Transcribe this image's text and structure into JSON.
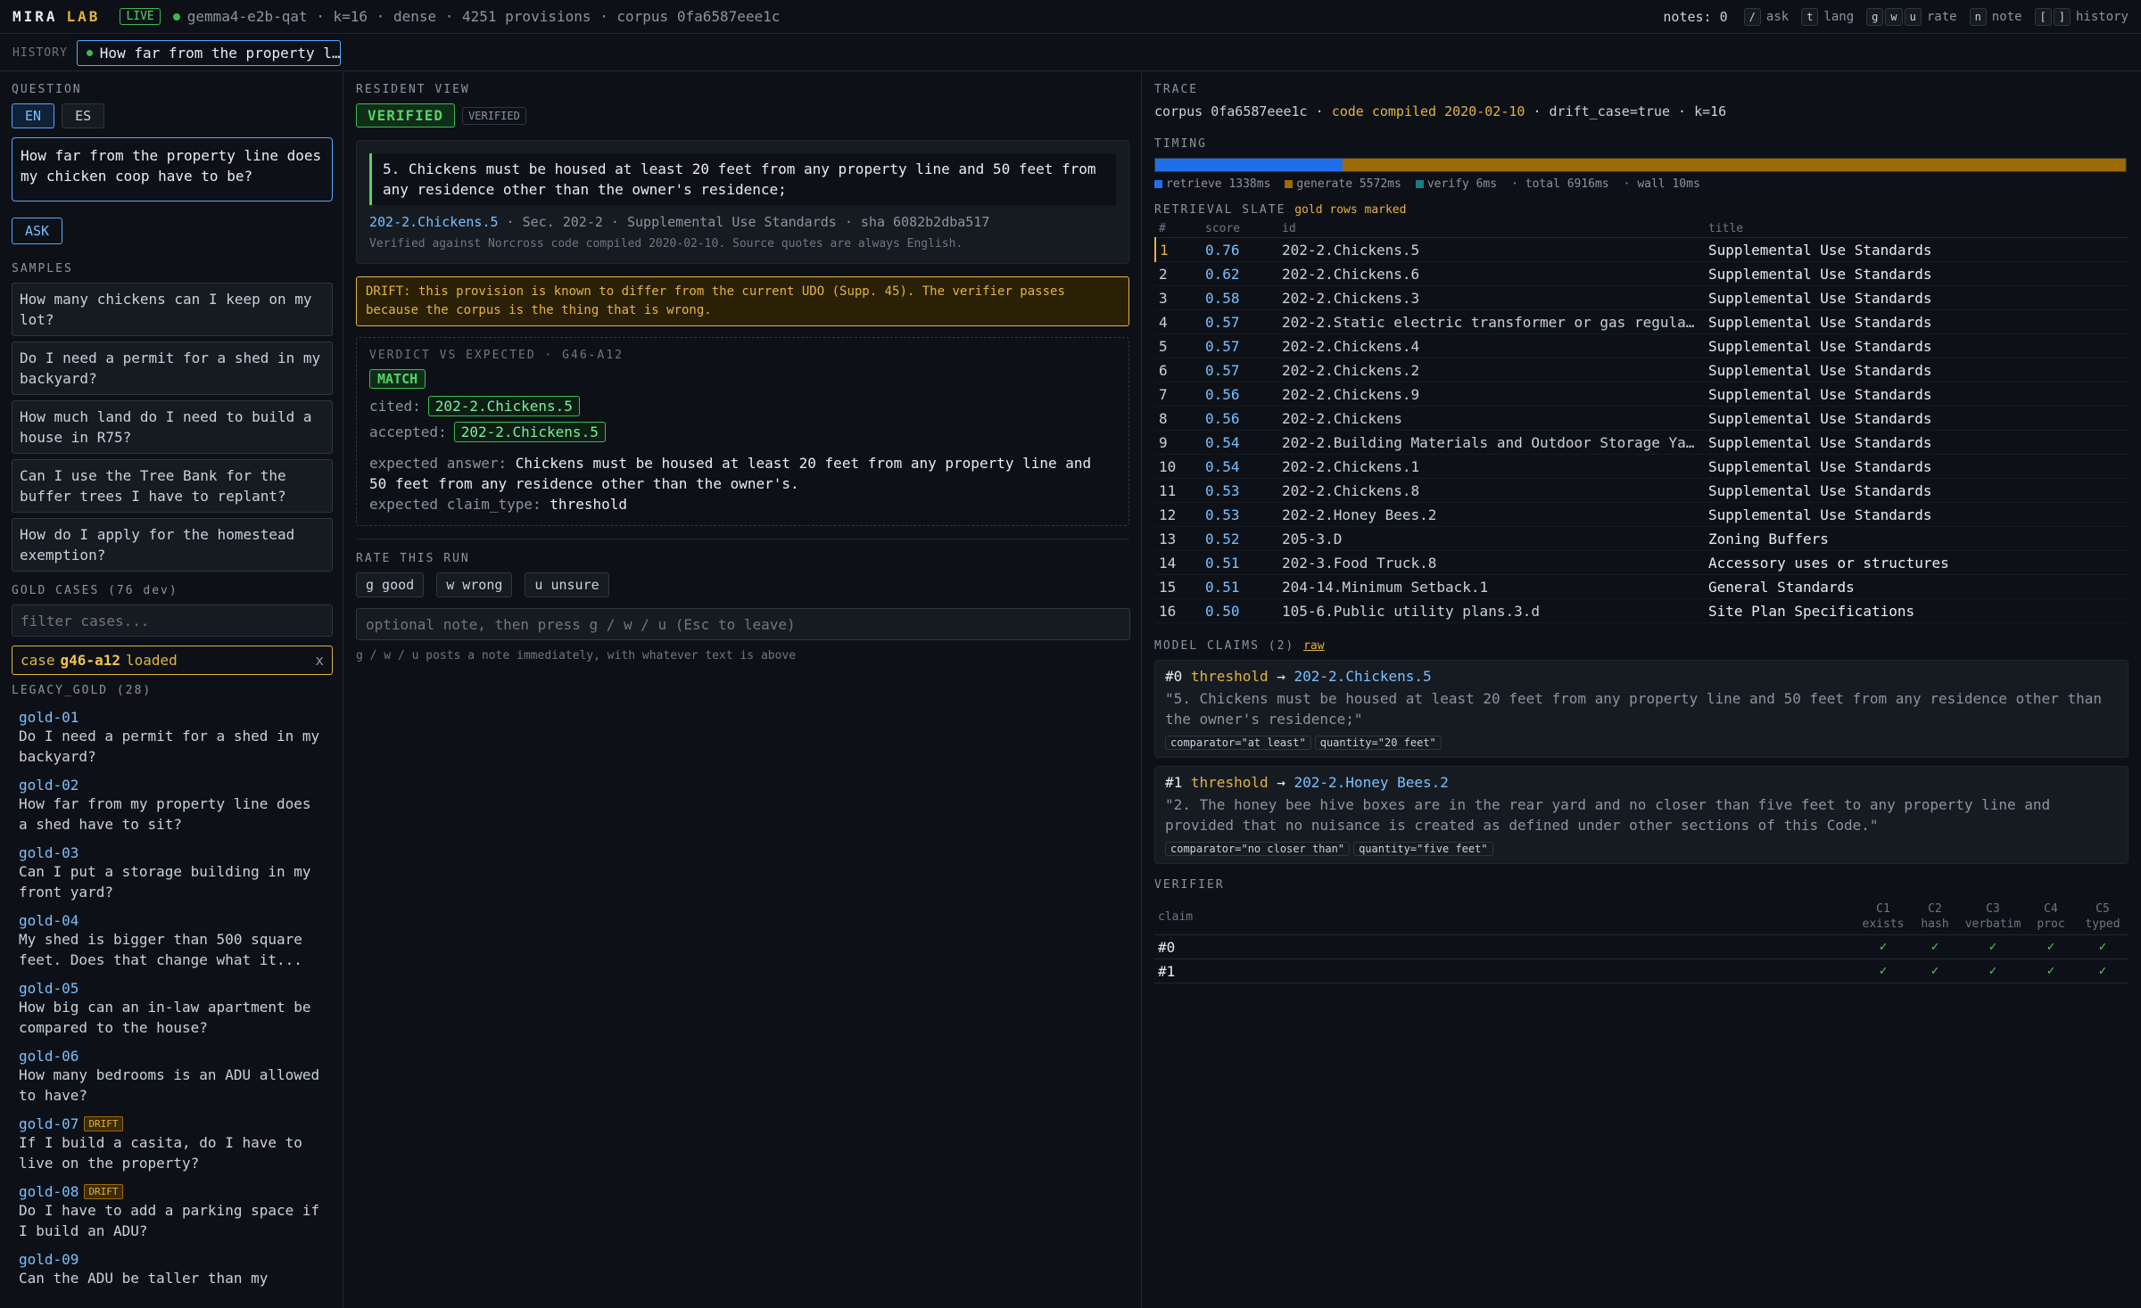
{
  "topbar": {
    "brand_a": "MIRA",
    "brand_b": "LAB",
    "live": "LIVE",
    "model_meta": "gemma4-e2b-qat · k=16 · dense · 4251 provisions · corpus 0fa6587eee1c",
    "notes": "notes: 0",
    "shortcuts": [
      {
        "keys": [
          "/"
        ],
        "label": "ask"
      },
      {
        "keys": [
          "t"
        ],
        "label": "lang"
      },
      {
        "keys": [
          "g",
          "w",
          "u"
        ],
        "label": "rate"
      },
      {
        "keys": [
          "n"
        ],
        "label": "note"
      },
      {
        "keys": [
          "[",
          "]"
        ],
        "label": "history"
      }
    ]
  },
  "history": {
    "label": "HISTORY",
    "chip": "How far from the property l…"
  },
  "left": {
    "question_heading": "QUESTION",
    "lang_en": "EN",
    "lang_es": "ES",
    "question_text": "How far from the property line does my chicken coop have to be?",
    "ask_label": "ASK",
    "samples_heading": "SAMPLES",
    "samples": [
      "How many chickens can I keep on my lot?",
      "Do I need a permit for a shed in my backyard?",
      "How much land do I need to build a house in R75?",
      "Can I use the Tree Bank for the buffer trees I have to replant?",
      "How do I apply for the homestead exemption?"
    ],
    "gold_heading": "GOLD CASES (76 dev)",
    "filter_placeholder": "filter cases...",
    "case_prefix": "case",
    "case_id": "g46-a12",
    "case_suffix": "loaded",
    "case_close": "x",
    "legacy_heading": "LEGACY_GOLD (28)",
    "drift_badge": "DRIFT",
    "gold_cases": [
      {
        "id": "gold-01",
        "q": "Do I need a permit for a shed in my backyard?",
        "drift": false
      },
      {
        "id": "gold-02",
        "q": "How far from my property line does a shed have to sit?",
        "drift": false
      },
      {
        "id": "gold-03",
        "q": "Can I put a storage building in my front yard?",
        "drift": false
      },
      {
        "id": "gold-04",
        "q": "My shed is bigger than 500 square feet. Does that change what it...",
        "drift": false
      },
      {
        "id": "gold-05",
        "q": "How big can an in-law apartment be compared to the house?",
        "drift": false
      },
      {
        "id": "gold-06",
        "q": "How many bedrooms is an ADU allowed to have?",
        "drift": false
      },
      {
        "id": "gold-07",
        "q": "If I build a casita, do I have to live on the property?",
        "drift": true
      },
      {
        "id": "gold-08",
        "q": "Do I have to add a parking space if I build an ADU?",
        "drift": true
      },
      {
        "id": "gold-09",
        "q": "Can the ADU be taller than my",
        "drift": false
      }
    ]
  },
  "mid": {
    "heading": "RESIDENT VIEW",
    "verified_big": "VERIFIED",
    "verified_small": "VERIFIED",
    "quote": "5. Chickens must be housed at least 20 feet from any property line and 50 feet from any residence other than the owner's residence;",
    "cite_id": "202-2.Chickens.5",
    "cite_rest": " · Sec. 202-2 · Supplemental Use Standards · sha 6082b2dba517",
    "verified_note": "Verified against Norcross code compiled 2020-02-10. Source quotes are always English.",
    "drift_text": "DRIFT: this provision is known to differ from the current UDO (Supp. 45). The verifier passes because the corpus is the thing that is wrong.",
    "verdict_heading": "VERDICT VS EXPECTED · G46-A12",
    "match": "MATCH",
    "cited_label": "cited:",
    "cited_id": "202-2.Chickens.5",
    "accepted_label": "accepted:",
    "accepted_id": "202-2.Chickens.5",
    "expected_answer_label": "expected answer:",
    "expected_answer": "Chickens must be housed at least 20 feet from any property line and 50 feet from any residence other than the owner's.",
    "expected_type_label": "expected claim_type:",
    "expected_type": "threshold",
    "rate_heading": "RATE THIS RUN",
    "rate_good": "g good",
    "rate_wrong": "w wrong",
    "rate_unsure": "u unsure",
    "note_placeholder": "optional note, then press g / w / u (Esc to leave)",
    "hint": "g / w / u posts a note immediately, with whatever text is above"
  },
  "right": {
    "trace_heading": "TRACE",
    "trace_corpus": "corpus 0fa6587eee1c · ",
    "trace_compiled": "code compiled 2020-02-10",
    "trace_rest": " · drift_case=true · k=16",
    "timing_heading": "TIMING",
    "timing": {
      "retrieve_ms": 1338,
      "generate_ms": 5572,
      "verify_ms": 6,
      "total_ms": 6916
    },
    "timing_legend": {
      "retrieve": "retrieve 1338ms",
      "generate": "generate 5572ms",
      "verify": "verify 6ms",
      "total": "· total 6916ms",
      "wall": "· wall 10ms"
    },
    "timing_colors": {
      "retrieve": "#1f6feb",
      "generate": "#9e6a03",
      "verify": "#1b7c83"
    },
    "slate_heading": "RETRIEVAL SLATE",
    "slate_note": "gold rows marked",
    "slate_cols": [
      "#",
      "score",
      "id",
      "title"
    ],
    "slate": [
      {
        "n": "1",
        "score": "0.76",
        "id": "202-2.Chickens.5",
        "title": "Supplemental Use Standards",
        "gold": true
      },
      {
        "n": "2",
        "score": "0.62",
        "id": "202-2.Chickens.6",
        "title": "Supplemental Use Standards",
        "gold": false
      },
      {
        "n": "3",
        "score": "0.58",
        "id": "202-2.Chickens.3",
        "title": "Supplemental Use Standards",
        "gold": false
      },
      {
        "n": "4",
        "score": "0.57",
        "id": "202-2.Static electric transformer or gas regula…",
        "title": "Supplemental Use Standards",
        "gold": false
      },
      {
        "n": "5",
        "score": "0.57",
        "id": "202-2.Chickens.4",
        "title": "Supplemental Use Standards",
        "gold": false
      },
      {
        "n": "6",
        "score": "0.57",
        "id": "202-2.Chickens.2",
        "title": "Supplemental Use Standards",
        "gold": false
      },
      {
        "n": "7",
        "score": "0.56",
        "id": "202-2.Chickens.9",
        "title": "Supplemental Use Standards",
        "gold": false
      },
      {
        "n": "8",
        "score": "0.56",
        "id": "202-2.Chickens",
        "title": "Supplemental Use Standards",
        "gold": false
      },
      {
        "n": "9",
        "score": "0.54",
        "id": "202-2.Building Materials and Outdoor Storage Ya…",
        "title": "Supplemental Use Standards",
        "gold": false
      },
      {
        "n": "10",
        "score": "0.54",
        "id": "202-2.Chickens.1",
        "title": "Supplemental Use Standards",
        "gold": false
      },
      {
        "n": "11",
        "score": "0.53",
        "id": "202-2.Chickens.8",
        "title": "Supplemental Use Standards",
        "gold": false
      },
      {
        "n": "12",
        "score": "0.53",
        "id": "202-2.Honey Bees.2",
        "title": "Supplemental Use Standards",
        "gold": false
      },
      {
        "n": "13",
        "score": "0.52",
        "id": "205-3.D",
        "title": "Zoning Buffers",
        "gold": false
      },
      {
        "n": "14",
        "score": "0.51",
        "id": "202-3.Food Truck.8",
        "title": "Accessory uses or structures",
        "gold": false
      },
      {
        "n": "15",
        "score": "0.51",
        "id": "204-14.Minimum Setback.1",
        "title": "General Standards",
        "gold": false
      },
      {
        "n": "16",
        "score": "0.50",
        "id": "105-6.Public utility plans.3.d",
        "title": "Site Plan Specifications",
        "gold": false
      }
    ],
    "claims_heading": "MODEL CLAIMS (2)",
    "claims_raw": "raw",
    "claims": [
      {
        "idx": "#0",
        "type": "threshold",
        "arrow": "→",
        "target": "202-2.Chickens.5",
        "quote": "\"5. Chickens must be housed at least 20 feet from any property line and 50 feet from any residence other than the owner's residence;\"",
        "pills": [
          "comparator=\"at least\"",
          "quantity=\"20 feet\""
        ]
      },
      {
        "idx": "#1",
        "type": "threshold",
        "arrow": "→",
        "target": "202-2.Honey Bees.2",
        "quote": "\"2. The honey bee hive boxes are in the rear yard and no closer than five feet to any property line and provided that no nuisance is created as defined under other sections of this Code.\"",
        "pills": [
          "comparator=\"no closer than\"",
          "quantity=\"five feet\""
        ]
      }
    ],
    "verifier_heading": "VERIFIER",
    "verifier_claim_col": "claim",
    "verifier_cols": [
      {
        "a": "C1",
        "b": "exists"
      },
      {
        "a": "C2",
        "b": "hash"
      },
      {
        "a": "C3",
        "b": "verbatim"
      },
      {
        "a": "C4",
        "b": "proc"
      },
      {
        "a": "C5",
        "b": "typed"
      }
    ],
    "verifier_rows": [
      {
        "claim": "#0",
        "checks": [
          "✓",
          "✓",
          "✓",
          "✓",
          "✓"
        ]
      },
      {
        "claim": "#1",
        "checks": [
          "✓",
          "✓",
          "✓",
          "✓",
          "✓"
        ]
      }
    ]
  }
}
